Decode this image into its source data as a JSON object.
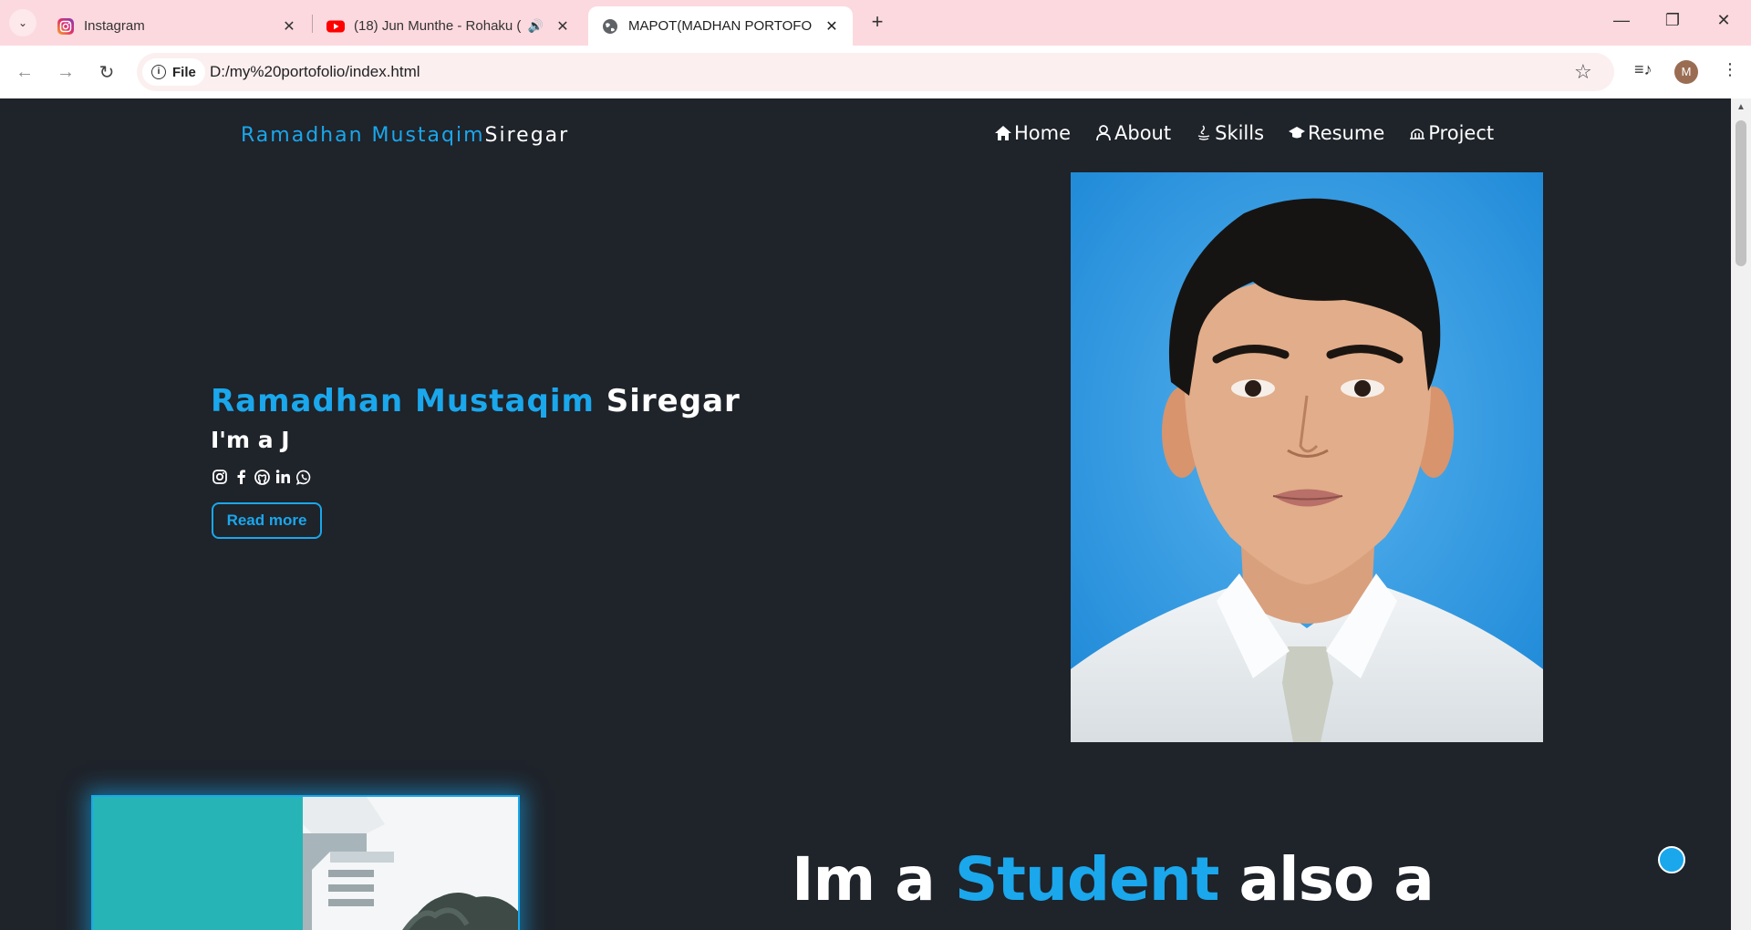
{
  "browser": {
    "tabs": [
      {
        "title": "Instagram",
        "favicon": "instagram-icon"
      },
      {
        "title": "(18) Jun Munthe - Rohaku (",
        "favicon": "youtube-icon",
        "audio": true
      },
      {
        "title": "MAPOT(MADHAN PORTOFOLIO",
        "favicon": "globe-icon",
        "active": true
      }
    ],
    "omnibox": {
      "chip_label": "File",
      "url": "D:/my%20portofolio/index.html"
    },
    "profile_initial": "M"
  },
  "site": {
    "brand": {
      "first": "Ramadhan Mustaqim",
      "last": "Siregar"
    },
    "nav": [
      {
        "label": "Home",
        "icon": "home-icon"
      },
      {
        "label": "About",
        "icon": "user-icon"
      },
      {
        "label": "Skills",
        "icon": "java-icon"
      },
      {
        "label": "Resume",
        "icon": "graduation-cap-icon"
      },
      {
        "label": "Project",
        "icon": "project-icon"
      }
    ],
    "hero": {
      "name_first": "Ramadhan Mustaqim",
      "name_last": "Siregar",
      "typed_text": "I'm a J",
      "socials": [
        "instagram-icon",
        "facebook-icon",
        "github-icon",
        "linkedin-icon",
        "whatsapp-icon"
      ],
      "read_more": "Read more"
    },
    "about": {
      "title_prefix": "Im a",
      "title_highlight": "Student",
      "title_suffix": "also a"
    }
  },
  "colors": {
    "accent": "#1aa7ec",
    "background": "#1f232a",
    "tabbar": "#fcd9de"
  }
}
